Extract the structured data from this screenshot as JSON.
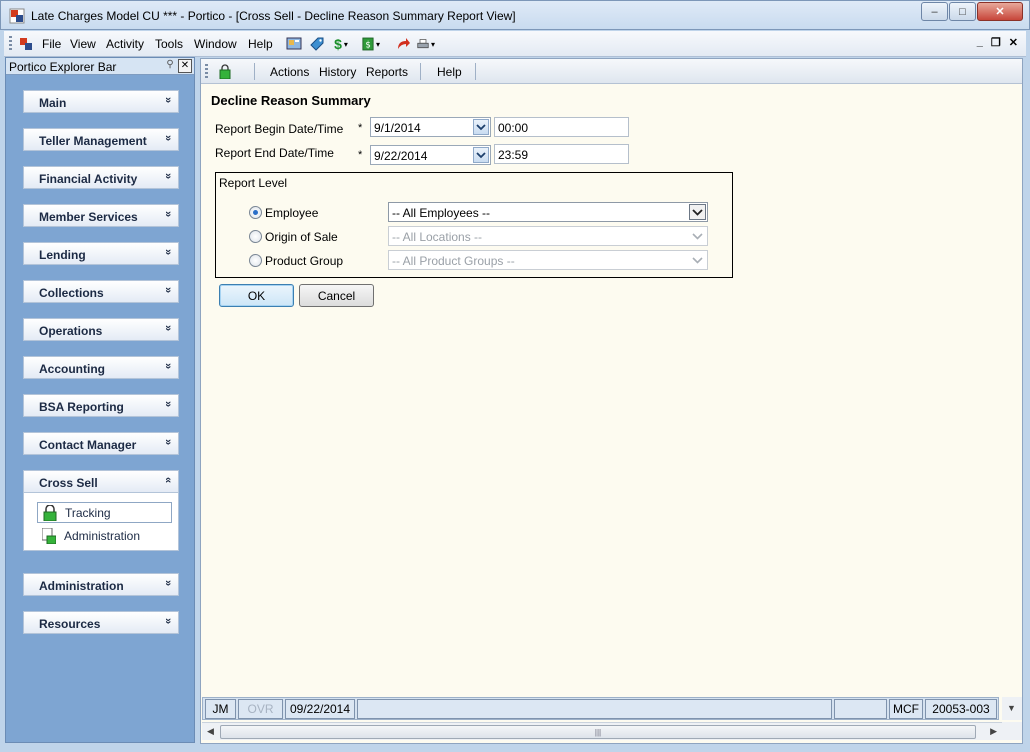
{
  "window": {
    "title": "Late Charges Model CU *** - Portico - [Cross Sell - Decline Reason Summary Report View]",
    "minimize": "–",
    "maximize": "□",
    "close": "✕"
  },
  "menu": {
    "items": [
      "File",
      "View",
      "Activity",
      "Tools",
      "Window",
      "Help"
    ],
    "mdi_min": "_",
    "mdi_restore": "❐",
    "mdi_close": "✕"
  },
  "explorer": {
    "title": "Portico Explorer Bar",
    "groups": [
      {
        "label": "Main",
        "chevron": "»"
      },
      {
        "label": "Teller Management",
        "chevron": "»"
      },
      {
        "label": "Financial Activity",
        "chevron": "»"
      },
      {
        "label": "Member Services",
        "chevron": "»"
      },
      {
        "label": "Lending",
        "chevron": "»"
      },
      {
        "label": "Collections",
        "chevron": "»"
      },
      {
        "label": "Operations",
        "chevron": "»"
      },
      {
        "label": "Accounting",
        "chevron": "»"
      },
      {
        "label": "BSA Reporting",
        "chevron": "»"
      },
      {
        "label": "Contact Manager",
        "chevron": "»"
      },
      {
        "label": "Cross Sell",
        "chevron": "«"
      },
      {
        "label": "Administration",
        "chevron": "»"
      },
      {
        "label": "Resources",
        "chevron": "»"
      }
    ],
    "cross_sell_items": [
      {
        "label": "Tracking",
        "selected": true
      },
      {
        "label": "Administration",
        "selected": false
      }
    ]
  },
  "child_toolbar": {
    "items": [
      "Actions",
      "History",
      "Reports",
      "Help"
    ]
  },
  "form": {
    "title": "Decline Reason Summary",
    "begin_label": "Report Begin Date/Time",
    "end_label": "Report End Date/Time",
    "required_mark": "*",
    "begin_date": "9/1/2014",
    "begin_time": "00:00",
    "end_date": "9/22/2014",
    "end_time": "23:59",
    "report_level": {
      "title": "Report Level",
      "options": [
        {
          "label": "Employee",
          "selected": true,
          "value": "-- All Employees --",
          "enabled": true
        },
        {
          "label": "Origin of Sale",
          "selected": false,
          "value": "-- All Locations --",
          "enabled": false
        },
        {
          "label": "Product Group",
          "selected": false,
          "value": "-- All Product Groups --",
          "enabled": false
        }
      ]
    },
    "ok_label": "OK",
    "cancel_label": "Cancel"
  },
  "status": {
    "user": "JM",
    "ovr": "OVR",
    "date": "09/22/2014",
    "branch": "MCF",
    "code": "20053-003"
  },
  "colors": {
    "form_bg": "#fdfbf0",
    "explorer_bg": "#7ea5d2",
    "accent": "#2b6fc8"
  }
}
